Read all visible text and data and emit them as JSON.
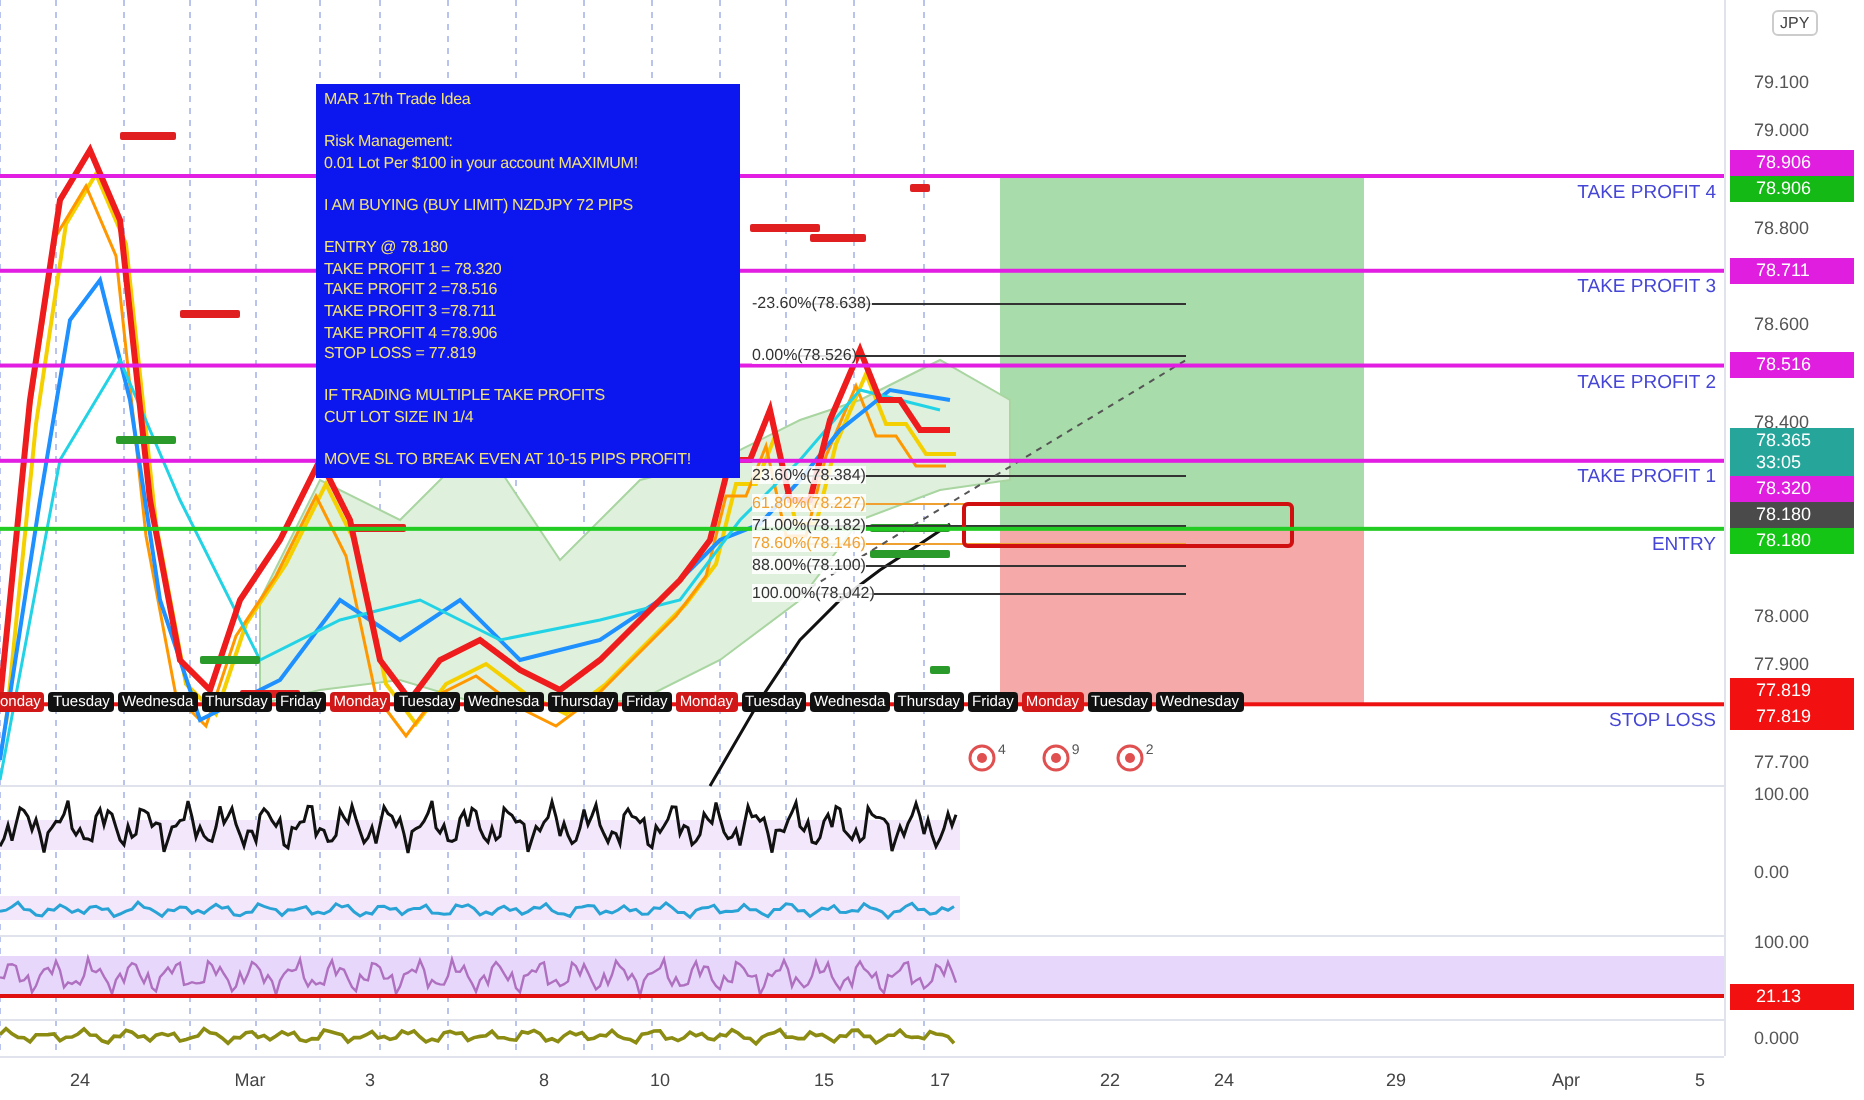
{
  "info_box": {
    "paragraphs": [
      [
        "MAR 17th Trade Idea"
      ],
      [
        "Risk Management:",
        "0.01 Lot Per $100 in your account MAXIMUM!"
      ],
      [
        "I AM BUYING (BUY LIMIT) NZDJPY 72 PIPS"
      ],
      [
        "ENTRY @ 78.180",
        "TAKE PROFIT 1 = 78.320",
        "TAKE PROFIT 2 =78.516",
        "TAKE PROFIT 3 =78.711",
        "TAKE PROFIT 4 =78.906",
        "STOP LOSS = 77.819"
      ],
      [
        "IF TRADING MULTIPLE TAKE PROFITS",
        "CUT LOT SIZE IN 1/4"
      ],
      [
        "MOVE SL TO BREAK EVEN AT 10-15 PIPS PROFIT!"
      ]
    ]
  },
  "price_levels": [
    {
      "label": "TAKE PROFIT 4",
      "color": "#e11ee1",
      "badges": [
        {
          "text": "78.906",
          "color": "#e01ee0"
        },
        {
          "text": "78.906",
          "color": "#15b915"
        }
      ]
    },
    {
      "label": "TAKE PROFIT 3",
      "color": "#e11ee1",
      "badges": [
        {
          "text": "78.711",
          "color": "#e01ee0"
        }
      ]
    },
    {
      "label": "TAKE PROFIT 2",
      "color": "#e11ee1",
      "badges": [
        {
          "text": "78.516",
          "color": "#e01ee0"
        }
      ]
    },
    {
      "label": "TAKE PROFIT 1",
      "color": "#e11ee1",
      "badges": [
        {
          "text": "78.320",
          "color": "#e01ee0"
        }
      ]
    },
    {
      "label": "ENTRY",
      "color": "#22cc22",
      "badges": [
        {
          "text": "78.180",
          "color": "#4a4a4a"
        },
        {
          "text": "78.180",
          "color": "#15c515"
        }
      ]
    },
    {
      "label": "STOP LOSS",
      "color": "#ee1111",
      "badges": [
        {
          "text": "77.819",
          "color": "#f21010"
        },
        {
          "text": "77.819",
          "color": "#f21010"
        }
      ]
    }
  ],
  "fib_levels": [
    {
      "label": "-23.60%(78.638)",
      "color": "#333333"
    },
    {
      "label": "0.00%(78.526)",
      "color": "#333333"
    },
    {
      "label": "23.60%(78.384)",
      "color": "#333333"
    },
    {
      "label": "61.80%(78.227)",
      "color": "#f0a030"
    },
    {
      "label": "71.00%(78.182)",
      "color": "#333333"
    },
    {
      "label": "78.60%(78.146)",
      "color": "#f0a030"
    },
    {
      "label": "88.00%(78.100)",
      "color": "#333333"
    },
    {
      "label": "100.00%(78.042)",
      "color": "#333333"
    }
  ],
  "day_labels": [
    {
      "text": "onday",
      "color": "#d01818"
    },
    {
      "text": "Tuesday",
      "color": "#111111"
    },
    {
      "text": "Wednesda",
      "color": "#111111"
    },
    {
      "text": "Thursday",
      "color": "#111111"
    },
    {
      "text": "Friday",
      "color": "#111111"
    },
    {
      "text": "Monday",
      "color": "#d01818"
    },
    {
      "text": "Tuesday",
      "color": "#111111"
    },
    {
      "text": "Wednesda",
      "color": "#111111"
    },
    {
      "text": "Thursday",
      "color": "#111111"
    },
    {
      "text": "Friday",
      "color": "#111111"
    },
    {
      "text": "Monday",
      "color": "#d01818"
    },
    {
      "text": "Tuesday",
      "color": "#111111"
    },
    {
      "text": "Wednesda",
      "color": "#111111"
    },
    {
      "text": "Thursday",
      "color": "#111111"
    },
    {
      "text": "Friday",
      "color": "#111111"
    },
    {
      "text": "Monday",
      "color": "#d01818"
    },
    {
      "text": "Tuesday",
      "color": "#111111"
    },
    {
      "text": "Wednesday",
      "color": "#111111"
    }
  ],
  "alert_icons": [
    {
      "count": "4"
    },
    {
      "count": "9"
    },
    {
      "count": "2"
    }
  ],
  "price_axis": {
    "currency": "JPY",
    "ticks": [
      "79.100",
      "79.000",
      "78.800",
      "78.600",
      "78.400",
      "78.000",
      "77.900",
      "77.700"
    ],
    "live_badge": {
      "text": "78.365",
      "countdown": "33:05",
      "color": "#26a69a"
    }
  },
  "indicator_axis": {
    "ticks": [
      "100.00",
      "0.00",
      "100.00",
      "0.000"
    ],
    "badge": {
      "text": "21.13",
      "color": "#f21010"
    }
  },
  "date_axis": [
    "24",
    "Mar",
    "3",
    "8",
    "10",
    "15",
    "17",
    "22",
    "24",
    "29",
    "Apr",
    "5"
  ]
}
